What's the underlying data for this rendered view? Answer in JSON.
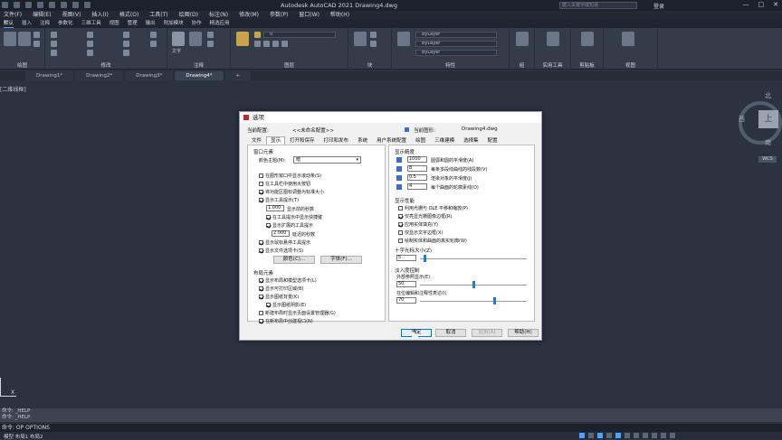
{
  "app": {
    "title": "Autodesk AutoCAD 2021   Drawing4.dwg",
    "search_placeholder": "键入关键字或短语",
    "login": "登录",
    "window_controls": [
      "—",
      "□",
      "✕"
    ]
  },
  "menubar": [
    "文件(F)",
    "编辑(E)",
    "视图(V)",
    "插入(I)",
    "格式(O)",
    "工具(T)",
    "绘图(D)",
    "标注(N)",
    "修改(M)",
    "参数(P)",
    "窗口(W)",
    "帮助(H)"
  ],
  "ribbon_tabs": {
    "items": [
      "默认",
      "插入",
      "注释",
      "参数化",
      "三维工具",
      "视图",
      "管理",
      "输出",
      "附加模块",
      "协作",
      "精选应用"
    ],
    "active": 0
  },
  "ribbon_panels": [
    "绘图",
    "修改",
    "注释",
    "图层",
    "块",
    "特性",
    "组",
    "实用工具",
    "剪贴板",
    "视图"
  ],
  "ribbon_labels": {
    "text": "文字",
    "bylayer": "ByLayer",
    "layer_value": "0"
  },
  "doc_tabs": {
    "items": [
      "Drawing1*",
      "Drawing2*",
      "Drawing3*",
      "Drawing4*"
    ],
    "active": 3,
    "add": "+"
  },
  "viewport_label": "[二维线框]",
  "viewcube": {
    "north": "北",
    "south": "南",
    "west": "西",
    "top": "上",
    "wcs": "WCS"
  },
  "ucs_x": "X",
  "command": {
    "history": [
      "命令: _HELP",
      "命令: _HELP"
    ],
    "current": "命令: OP OPTIONS"
  },
  "status": {
    "tabs": "模型  布局1  布局2"
  },
  "dialog": {
    "title": "选项",
    "current_profile_label": "当前配置:",
    "current_profile": "<<未命名配置>>",
    "current_drawing_label": "当前图形:",
    "current_drawing": "Drawing4.dwg",
    "tabs": [
      "文件",
      "显示",
      "打开和保存",
      "打印和发布",
      "系统",
      "用户系统配置",
      "绘图",
      "三维建模",
      "选择集",
      "配置"
    ],
    "active_tab": 1,
    "window_elements": {
      "heading": "窗口元素",
      "color_scheme_label": "颜色主题(M):",
      "color_scheme": "暗",
      "checks": [
        {
          "label": "在图形窗口中显示滚动条(S)",
          "checked": false
        },
        {
          "label": "在工具栏中使用大按钮",
          "checked": false
        },
        {
          "label": "将功能区图标调整为标准大小",
          "checked": true
        },
        {
          "label": "显示工具提示(T)",
          "checked": true
        }
      ],
      "delay_value": "1.000",
      "delay_label": "显示前的秒数",
      "sub_checks": [
        {
          "label": "在工具提示中显示快捷键",
          "checked": true
        },
        {
          "label": "显示扩展的工具提示",
          "checked": true
        }
      ],
      "delay2_value": "2.000",
      "delay2_label": "延迟的秒数",
      "checks2": [
        {
          "label": "显示鼠标悬停工具提示",
          "checked": true
        },
        {
          "label": "显示文件选项卡(S)",
          "checked": true
        }
      ],
      "color_button": "颜色(C)...",
      "font_button": "字体(F)..."
    },
    "layout_elements": {
      "heading": "布局元素",
      "checks": [
        {
          "label": "显示布局和模型选项卡(L)",
          "checked": true
        },
        {
          "label": "显示可打印区域(B)",
          "checked": true
        },
        {
          "label": "显示图纸背景(K)",
          "checked": true
        },
        {
          "label": "显示图纸阴影(E)",
          "checked": true
        },
        {
          "label": "新建布局时显示页面设置管理器(G)",
          "checked": false
        },
        {
          "label": "在新布局中创建视口(N)",
          "checked": true
        }
      ]
    },
    "display_resolution": {
      "heading": "显示精度",
      "rows": [
        {
          "value": "1000",
          "label": "圆弧和圆的平滑度(A)"
        },
        {
          "value": "8",
          "label": "每条多段线曲线的线段数(V)"
        },
        {
          "value": "0.5",
          "label": "渲染对象的平滑度(J)"
        },
        {
          "value": "4",
          "label": "每个曲面的轮廓素线(O)"
        }
      ]
    },
    "display_performance": {
      "heading": "显示性能",
      "checks": [
        {
          "label": "利用光栅与 OLE 平移和缩放(P)",
          "checked": false
        },
        {
          "label": "仅亮显光栅图像边框(R)",
          "checked": true
        },
        {
          "label": "应用实体填充(Y)",
          "checked": true
        },
        {
          "label": "仅显示文字边框(X)",
          "checked": false
        },
        {
          "label": "绘制实体和曲面的真实轮廓(W)",
          "checked": false
        }
      ]
    },
    "crosshair": {
      "heading": "十字光标大小(Z)",
      "value": "5",
      "fraction": 0.05
    },
    "fade_control": {
      "heading": "淡入度控制",
      "xref_label": "外部参照显示(E)",
      "xref_value": "50",
      "xref_fraction": 0.5,
      "inplace_label": "在位编辑和注释性表达(I)",
      "inplace_value": "70",
      "inplace_fraction": 0.7
    },
    "buttons": {
      "ok": "确定",
      "cancel": "取消",
      "apply": "应用(A)",
      "help": "帮助(H)"
    }
  }
}
